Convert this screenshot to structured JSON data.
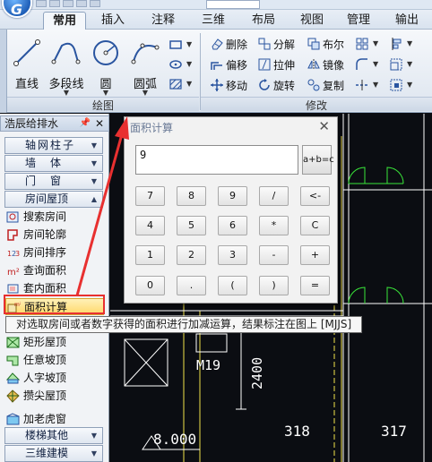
{
  "ribbon_tabs": [
    "常用",
    "插入",
    "注释",
    "三维",
    "布局",
    "视图",
    "管理",
    "输出"
  ],
  "ribbon": {
    "draw_group": {
      "label": "绘图",
      "buttons": [
        {
          "label": "直线",
          "icon": "line-icon"
        },
        {
          "label": "多段线",
          "icon": "polyline-icon"
        },
        {
          "label": "圆",
          "icon": "circle-icon"
        },
        {
          "label": "圆弧",
          "icon": "arc-icon"
        }
      ]
    },
    "modify_group": {
      "label": "修改",
      "buttons": [
        {
          "label": "删除",
          "icon": "erase-icon"
        },
        {
          "label": "分解",
          "icon": "explode-icon"
        },
        {
          "label": "布尔",
          "icon": "boolean-icon"
        },
        {
          "label": "偏移",
          "icon": "offset-icon"
        },
        {
          "label": "拉伸",
          "icon": "stretch-icon"
        },
        {
          "label": "镜像",
          "icon": "mirror-icon"
        },
        {
          "label": "移动",
          "icon": "move-icon"
        },
        {
          "label": "旋转",
          "icon": "rotate-icon"
        },
        {
          "label": "复制",
          "icon": "copy-icon"
        }
      ]
    }
  },
  "palette": {
    "title": "浩辰给排水",
    "categories": [
      "轴网柱子",
      "墙　体",
      "门　窗",
      "房间屋顶"
    ],
    "items": [
      "搜索房间",
      "房间轮廓",
      "房间排序",
      "查询面积",
      "套内面积",
      "面积计算",
      "矩形屋顶",
      "任意坡顶",
      "人字坡顶",
      "攒尖屋顶",
      "加老虎窗"
    ],
    "categories_bottom": [
      "楼梯其他",
      "三维建模"
    ],
    "selected_item": "面积计算"
  },
  "dialog": {
    "title": "面积计算",
    "display_value": "9",
    "eval_button": "a+b=c",
    "keys": [
      [
        "7",
        "8",
        "9",
        "/",
        "<-"
      ],
      [
        "4",
        "5",
        "6",
        "*",
        "C"
      ],
      [
        "1",
        "2",
        "3",
        "-",
        "+"
      ],
      [
        "0",
        ".",
        "(",
        ")",
        "="
      ]
    ]
  },
  "tooltip": "对选取房间或者数字获得的面积进行加减运算，结果标注在图上 [MJJS]",
  "cad": {
    "labels": [
      "M19",
      "2400",
      "8.000",
      "318",
      "317"
    ]
  },
  "colors": {
    "cad_background": "#0b0d12",
    "wall": "#ffffff",
    "door": "#39e639",
    "axis_yellow": "#f2e24a",
    "highlight_red": "#e83030"
  }
}
